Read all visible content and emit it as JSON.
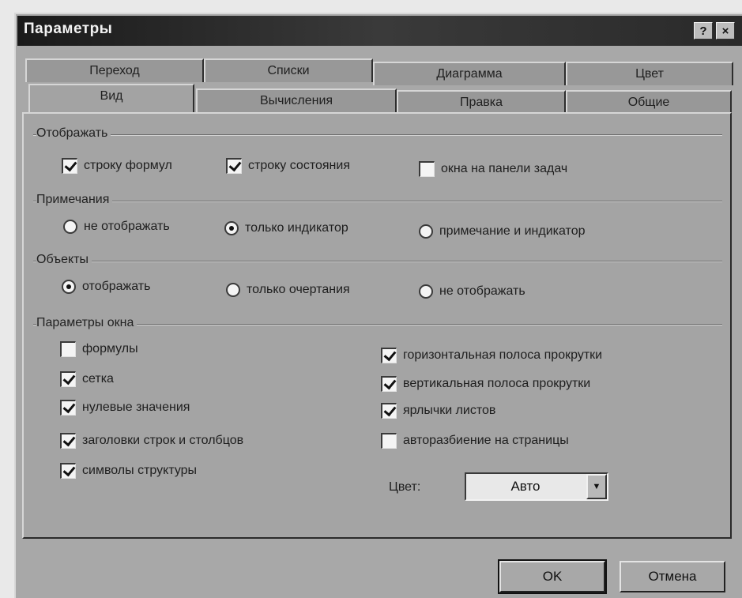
{
  "window": {
    "title": "Параметры",
    "help_button": "?",
    "close_button": "×"
  },
  "tabs_back": [
    "Переход",
    "Списки",
    "Диаграмма",
    "Цвет"
  ],
  "tabs_front": [
    "Вид",
    "Вычисления",
    "Правка",
    "Общие"
  ],
  "active_tab": "Вид",
  "groups": {
    "display": {
      "label": "Отображать",
      "items": [
        {
          "label": "строку формул",
          "checked": true
        },
        {
          "label": "строку состояния",
          "checked": true
        },
        {
          "label": "окна на панели задач",
          "checked": false
        }
      ]
    },
    "notes": {
      "label": "Примечания",
      "items": [
        {
          "label": "не отображать",
          "selected": false
        },
        {
          "label": "только индикатор",
          "selected": true
        },
        {
          "label": "примечание и индикатор",
          "selected": false
        }
      ]
    },
    "objects": {
      "label": "Объекты",
      "items": [
        {
          "label": "отображать",
          "selected": true
        },
        {
          "label": "только очертания",
          "selected": false
        },
        {
          "label": "не отображать",
          "selected": false
        }
      ]
    },
    "window_params": {
      "label": "Параметры окна",
      "left": [
        {
          "label": "формулы",
          "checked": false
        },
        {
          "label": "сетка",
          "checked": true
        },
        {
          "label": "нулевые значения",
          "checked": true
        },
        {
          "label": "заголовки строк и столбцов",
          "checked": true
        },
        {
          "label": "символы структуры",
          "checked": true
        }
      ],
      "right": [
        {
          "label": "горизонтальная полоса прокрутки",
          "checked": true
        },
        {
          "label": "вертикальная полоса прокрутки",
          "checked": true
        },
        {
          "label": "ярлычки листов",
          "checked": true
        },
        {
          "label": "авторазбиение на страницы",
          "checked": false
        }
      ],
      "color_label": "Цвет:",
      "color_value": "Авто"
    }
  },
  "buttons": {
    "ok": "OK",
    "cancel": "Отмена"
  }
}
